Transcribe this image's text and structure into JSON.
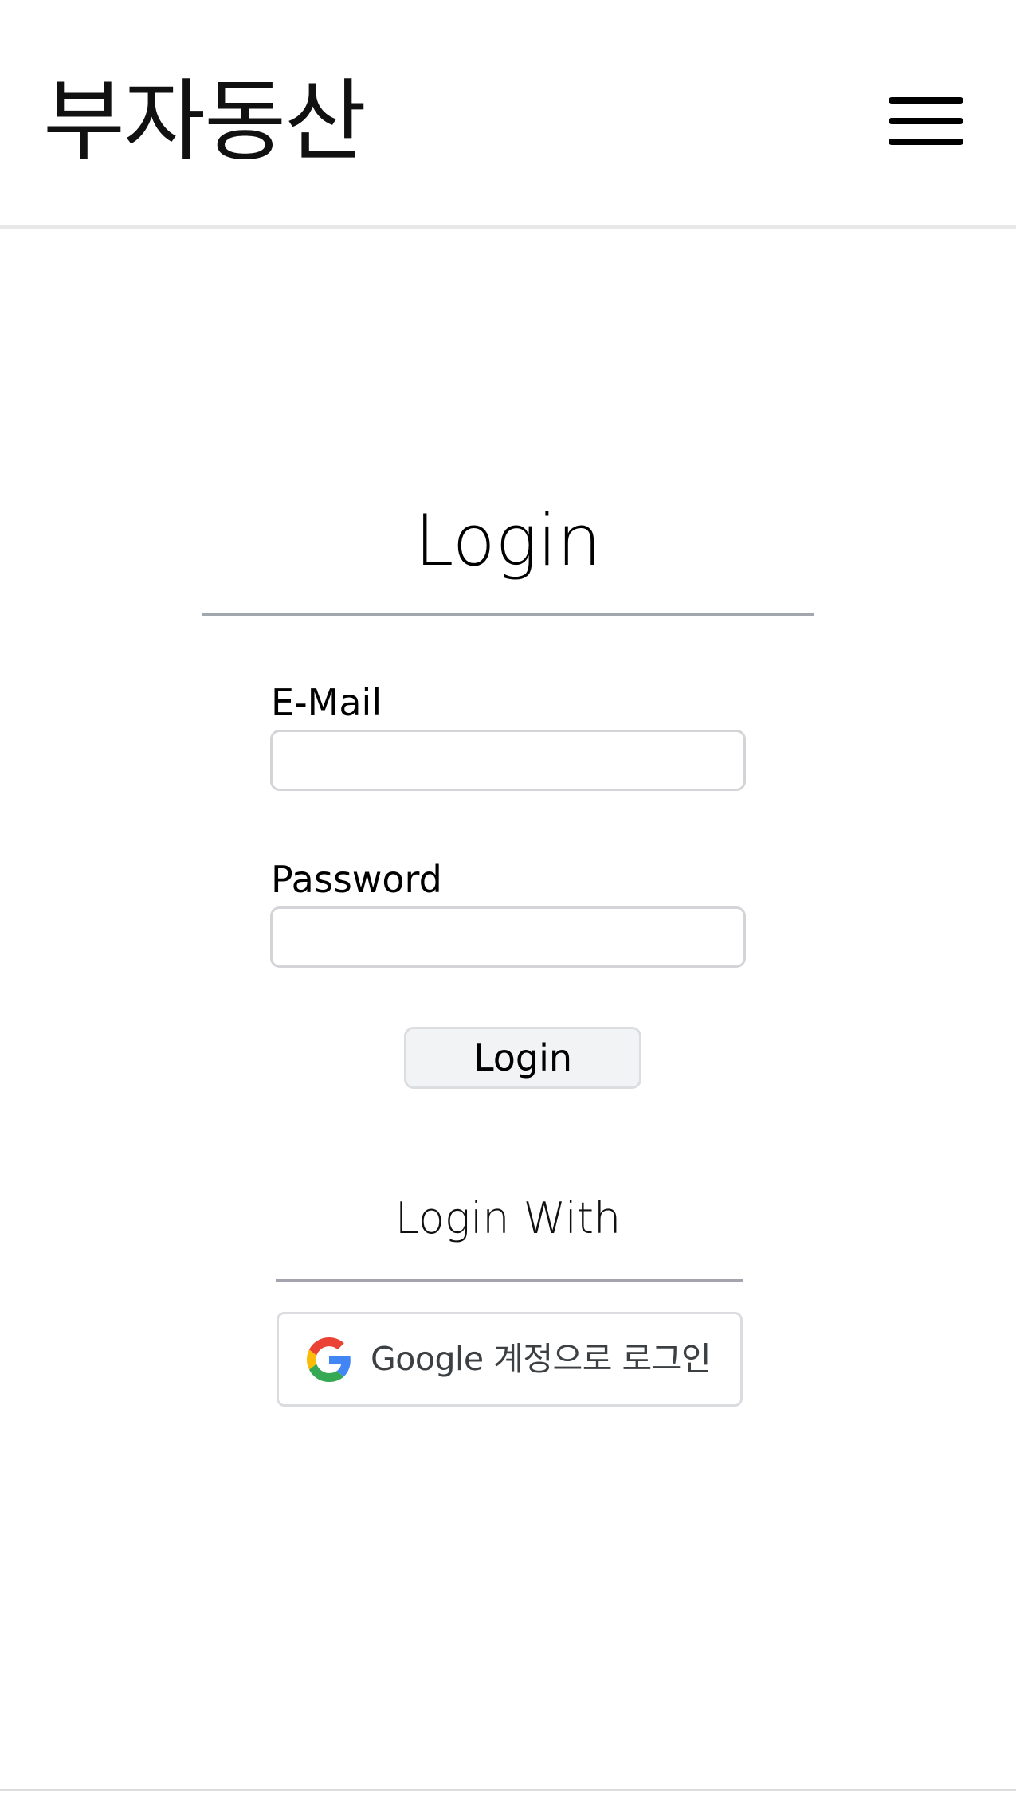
{
  "header": {
    "brand": "부자동산",
    "menu_icon": "hamburger-menu-icon"
  },
  "login": {
    "title": "Login",
    "email_label": "E-Mail",
    "email_value": "",
    "password_label": "Password",
    "password_value": "",
    "submit_label": "Login"
  },
  "social": {
    "heading": "Login With",
    "google_label": "Google 계정으로 로그인",
    "google_icon": "google-g-icon",
    "colors": {
      "blue": "#4285F4",
      "red": "#EA4335",
      "yellow": "#FBBC05",
      "green": "#34A853"
    }
  }
}
